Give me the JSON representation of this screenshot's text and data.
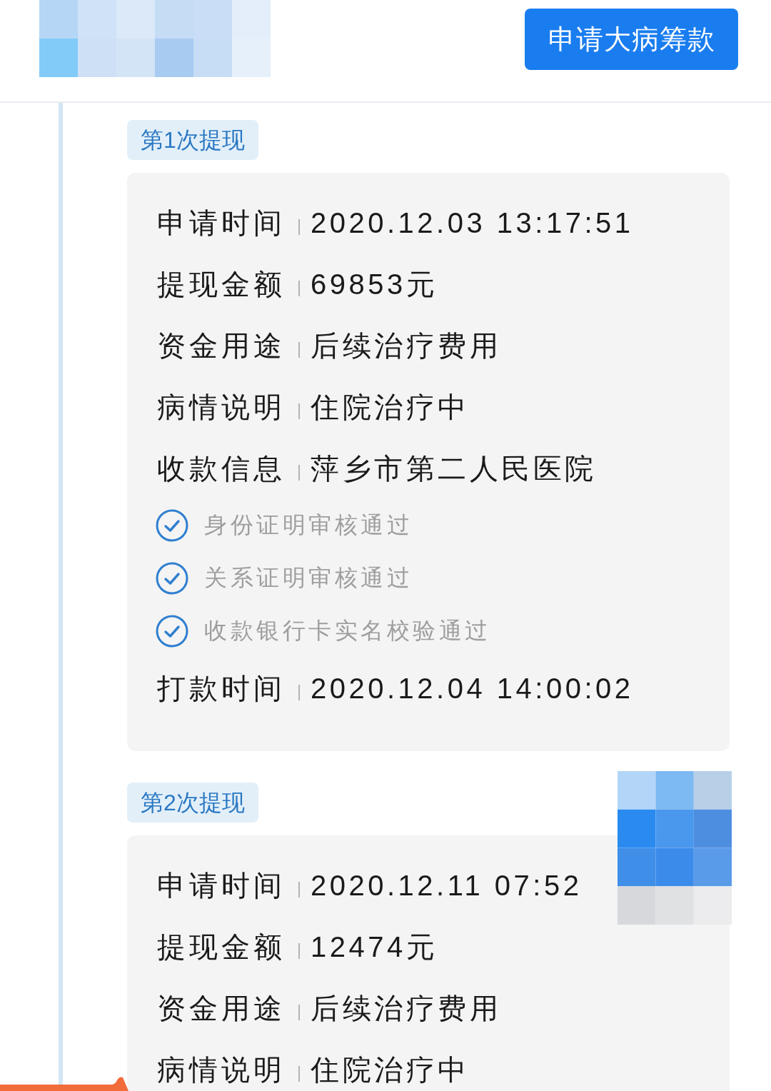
{
  "header": {
    "apply_button": "申请大病筹款"
  },
  "withdrawals": [
    {
      "tag": "第1次提现",
      "items": [
        {
          "kind": "field",
          "label": "申请时间",
          "value": "2020.12.03 13:17:51"
        },
        {
          "kind": "field",
          "label": "提现金额",
          "value": "69853元"
        },
        {
          "kind": "field",
          "label": "资金用途",
          "value": "后续治疗费用"
        },
        {
          "kind": "field",
          "label": "病情说明",
          "value": "住院治疗中"
        },
        {
          "kind": "field",
          "label": "收款信息",
          "value": "萍乡市第二人民医院"
        },
        {
          "kind": "check",
          "text": "身份证明审核通过",
          "checked": true
        },
        {
          "kind": "check",
          "text": "关系证明审核通过",
          "checked": true
        },
        {
          "kind": "check",
          "text": "收款银行卡实名校验通过",
          "checked": true
        },
        {
          "kind": "field",
          "label": "打款时间",
          "value": "2020.12.04 14:00:02"
        }
      ]
    },
    {
      "tag": "第2次提现",
      "items": [
        {
          "kind": "field",
          "label": "申请时间",
          "value": "2020.12.11 07:52"
        },
        {
          "kind": "field",
          "label": "提现金额",
          "value": "12474元"
        },
        {
          "kind": "field",
          "label": "资金用途",
          "value": "后续治疗费用"
        },
        {
          "kind": "field",
          "label": "病情说明",
          "value": "住院治疗中"
        }
      ]
    }
  ]
}
